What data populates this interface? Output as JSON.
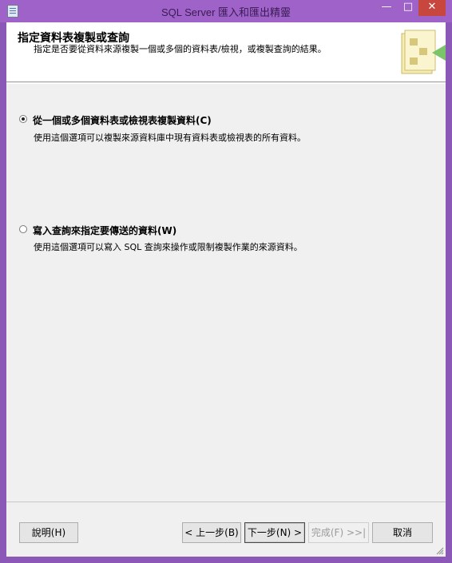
{
  "window": {
    "title": "SQL Server 匯入和匯出精靈",
    "controls": {
      "minimize": "—",
      "maximize": "□",
      "close": "✕"
    }
  },
  "header": {
    "title": "指定資料表複製或查詢",
    "subtitle": "指定是否要從資料來源複製一個或多個的資料表/檢視，或複製查詢的結果。"
  },
  "options": [
    {
      "label": "從一個或多個資料表或檢視表複製資料(C)",
      "description": "使用這個選項可以複製來源資料庫中現有資料表或檢視表的所有資料。",
      "selected": true
    },
    {
      "label": "寫入查詢來指定要傳送的資料(W)",
      "description": "使用這個選項可以寫入 SQL 查詢來操作或限制複製作業的來源資料。",
      "selected": false
    }
  ],
  "buttons": {
    "help": "說明(H)",
    "back": "< 上一步(B)",
    "next": "下一步(N) >",
    "finish": "完成(F) >>|",
    "cancel": "取消"
  },
  "colors": {
    "window_frame": "#9e62c9",
    "close_button": "#c7463e",
    "dialog_bg": "#f0f0f0"
  }
}
